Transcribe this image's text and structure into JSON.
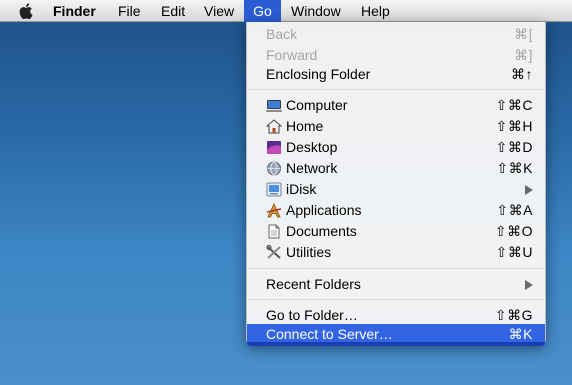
{
  "menubar": {
    "apple_icon": "apple-logo-icon",
    "items": [
      {
        "label": "Finder"
      },
      {
        "label": "File"
      },
      {
        "label": "Edit"
      },
      {
        "label": "View"
      },
      {
        "label": "Go"
      },
      {
        "label": "Window"
      },
      {
        "label": "Help"
      }
    ]
  },
  "go_menu": {
    "back": {
      "label": "Back",
      "shortcut": "⌘["
    },
    "forward": {
      "label": "Forward",
      "shortcut": "⌘]"
    },
    "enclosing": {
      "label": "Enclosing Folder",
      "shortcut": "⌘↑"
    },
    "computer": {
      "label": "Computer",
      "shortcut": "⇧⌘C",
      "icon": "computer-icon"
    },
    "home": {
      "label": "Home",
      "shortcut": "⇧⌘H",
      "icon": "home-icon"
    },
    "desktop": {
      "label": "Desktop",
      "shortcut": "⇧⌘D",
      "icon": "desktop-icon"
    },
    "network": {
      "label": "Network",
      "shortcut": "⇧⌘K",
      "icon": "network-icon"
    },
    "idisk": {
      "label": "iDisk",
      "icon": "idisk-icon"
    },
    "applications": {
      "label": "Applications",
      "shortcut": "⇧⌘A",
      "icon": "applications-icon"
    },
    "documents": {
      "label": "Documents",
      "shortcut": "⇧⌘O",
      "icon": "documents-icon"
    },
    "utilities": {
      "label": "Utilities",
      "shortcut": "⇧⌘U",
      "icon": "utilities-icon"
    },
    "recent": {
      "label": "Recent Folders"
    },
    "goto": {
      "label": "Go to Folder…",
      "shortcut": "⇧⌘G"
    },
    "connect": {
      "label": "Connect to Server…",
      "shortcut": "⌘K"
    }
  },
  "colors": {
    "highlight": "#3264e4",
    "menubar_active": "#2a5dd4",
    "disabled_text": "#a5a5a5"
  }
}
